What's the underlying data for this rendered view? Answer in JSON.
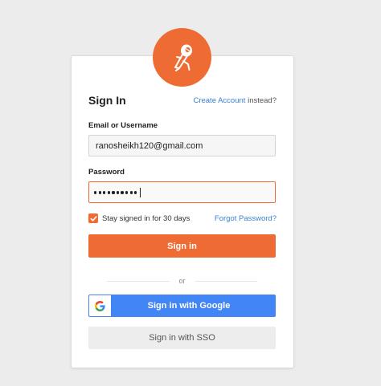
{
  "brand": {
    "logo_icon": "postman-astronaut-icon",
    "accent_color": "#ef6b34"
  },
  "signin": {
    "title": "Sign In",
    "create_account_link": "Create Account",
    "create_account_suffix": " instead?",
    "email_label": "Email or Username",
    "email_value": "ranosheikh120@gmail.com",
    "password_label": "Password",
    "password_length": 10,
    "remember_checked": true,
    "remember_label": "Stay signed in for 30 days",
    "forgot_password": "Forgot Password?",
    "submit_label": "Sign in",
    "divider_text": "or",
    "google_label": "Sign in with Google",
    "google_icon": "google-g-icon",
    "sso_label": "Sign in with SSO"
  }
}
